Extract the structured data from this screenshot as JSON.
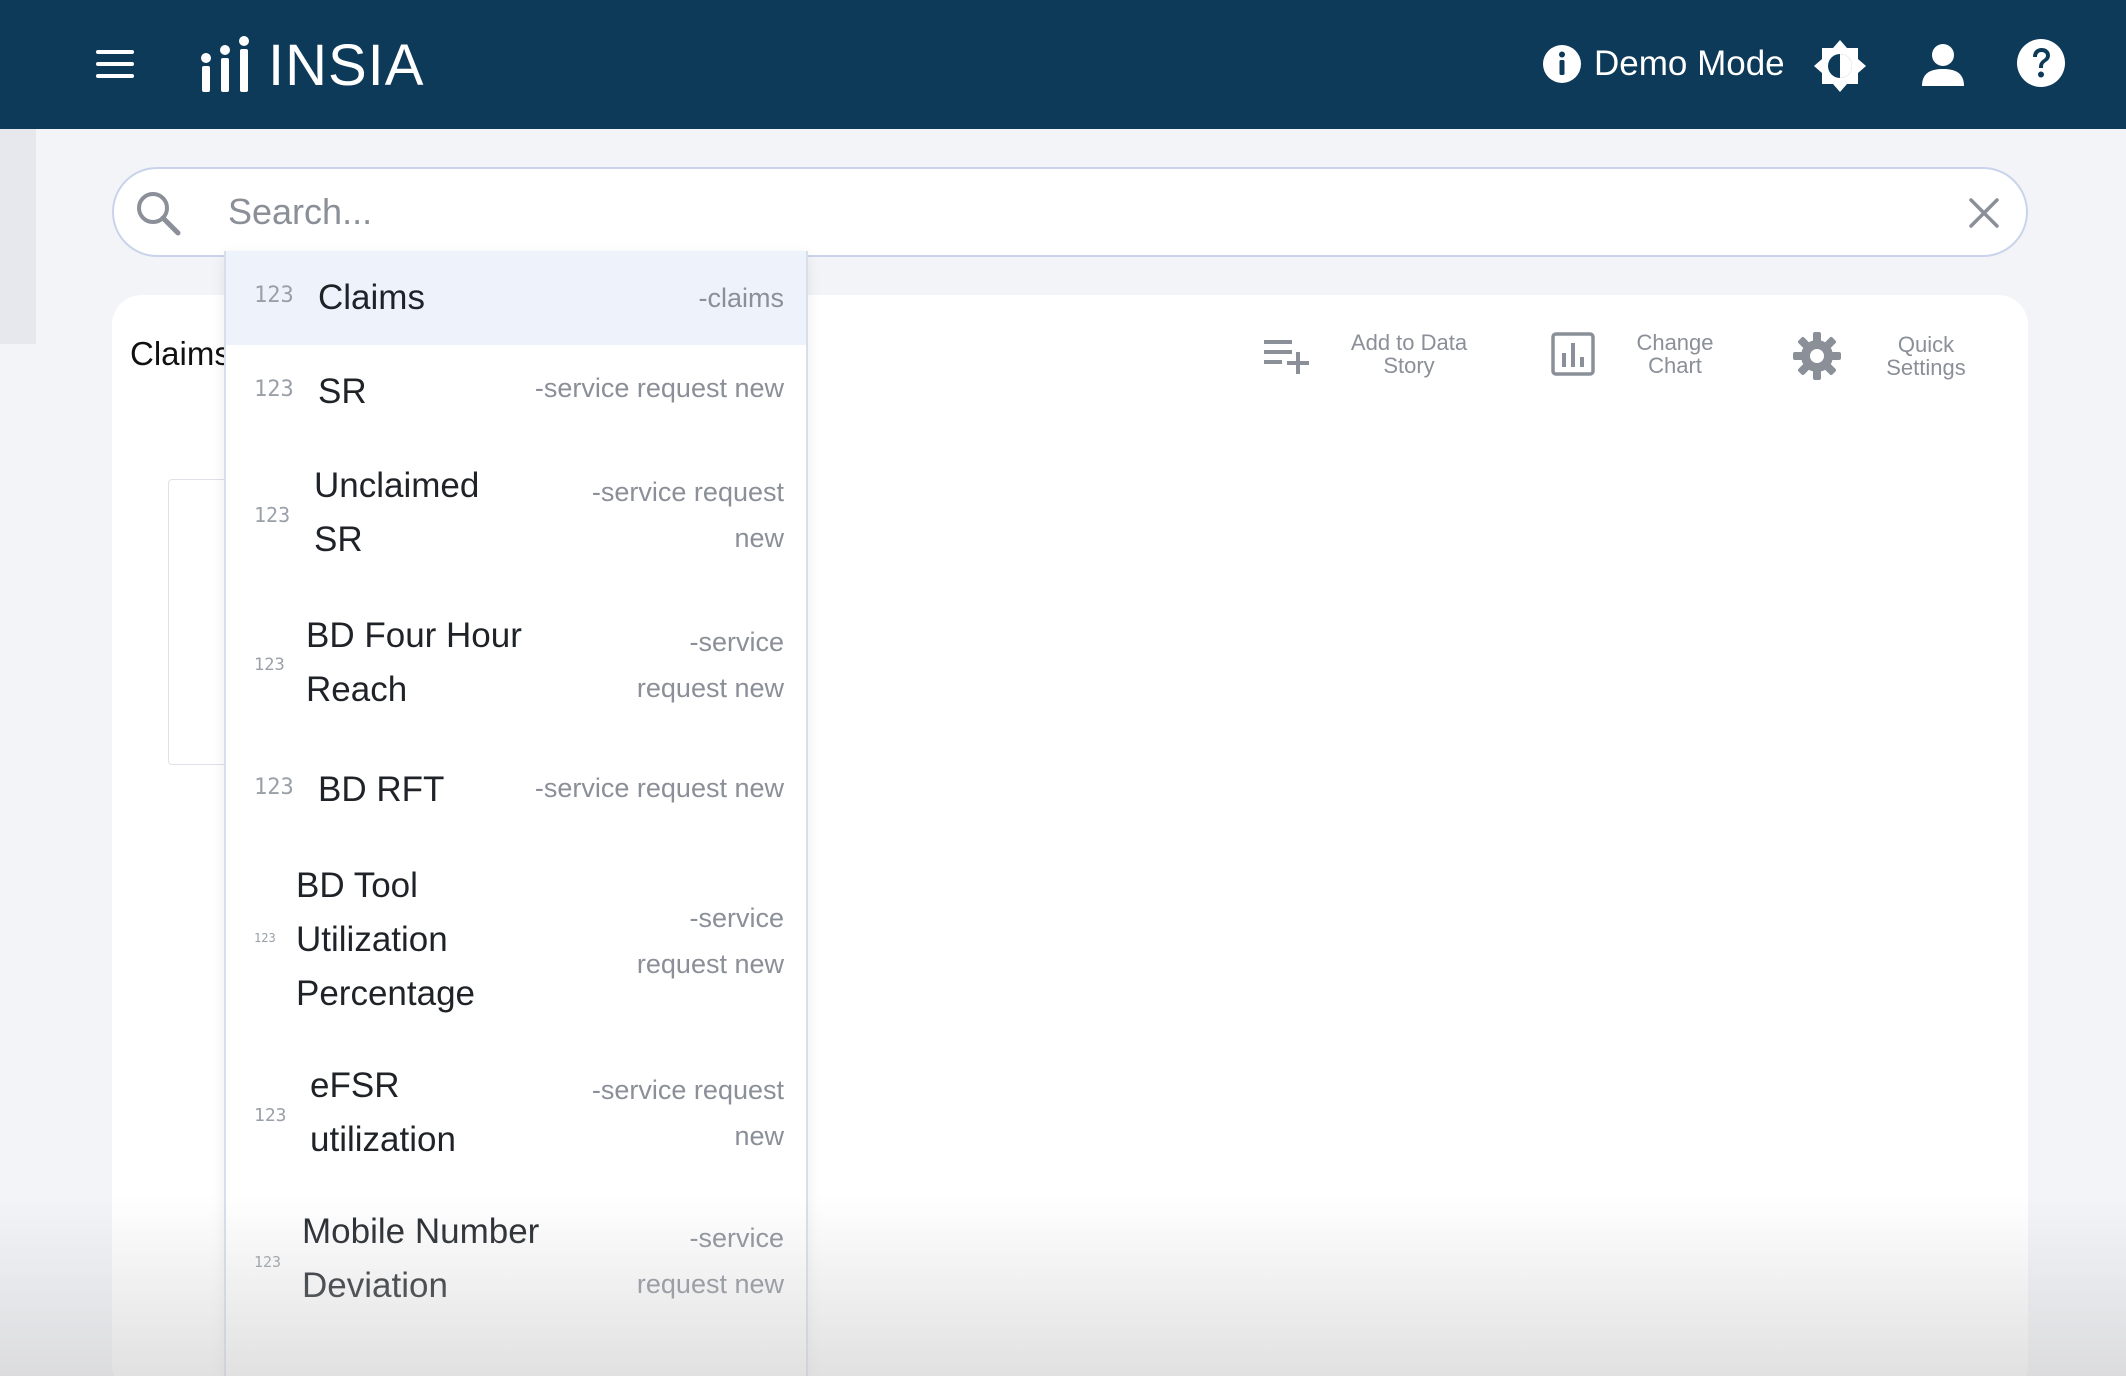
{
  "app": {
    "name": "INSIA",
    "demo_mode_label": "Demo Mode"
  },
  "colors": {
    "header_bg": "#0e3a5a",
    "page_bg": "#f3f4f8",
    "search_border": "#c9d4ea",
    "selected_row_bg": "#eef2fb"
  },
  "icons": {
    "menu": "menu-icon",
    "logo": "insia-logo-icon",
    "info": "info-icon",
    "theme": "brightness-icon",
    "user": "user-icon",
    "help": "help-icon",
    "search": "search-icon",
    "clear": "close-icon",
    "add_to_story": "playlist-add-icon",
    "change_chart": "bar-chart-icon",
    "quick_settings": "gear-icon"
  },
  "search": {
    "placeholder": "Search..."
  },
  "card": {
    "title": "Claims",
    "toolbar": {
      "add_to_story_line1": "Add to Data",
      "add_to_story_line2": "Story",
      "change_chart_line1": "Change",
      "change_chart_line2": "Chart",
      "quick_settings_line1": "Quick",
      "quick_settings_line2": "Settings"
    }
  },
  "suggestions": [
    {
      "type": "123",
      "name_lines": [
        "Claims"
      ],
      "source_lines": [
        "-claims"
      ]
    },
    {
      "type": "123",
      "name_lines": [
        "SR"
      ],
      "source_lines": [
        "-service request new"
      ]
    },
    {
      "type": "123",
      "name_lines": [
        "Unclaimed",
        "SR"
      ],
      "source_lines": [
        "-service request",
        "new"
      ]
    },
    {
      "type": "123",
      "name_lines": [
        "BD Four Hour",
        "Reach"
      ],
      "source_lines": [
        "-service",
        "request new"
      ]
    },
    {
      "type": "123",
      "name_lines": [
        "BD RFT"
      ],
      "source_lines": [
        "-service request new"
      ]
    },
    {
      "type": "123",
      "name_lines": [
        "BD Tool",
        "Utilization",
        "Percentage"
      ],
      "source_lines": [
        "-service",
        "request new"
      ]
    },
    {
      "type": "123",
      "name_lines": [
        "eFSR",
        "utilization"
      ],
      "source_lines": [
        "-service request",
        "new"
      ]
    },
    {
      "type": "123",
      "name_lines": [
        "Mobile Number",
        "Deviation"
      ],
      "source_lines": [
        "-service",
        "request new"
      ]
    }
  ]
}
